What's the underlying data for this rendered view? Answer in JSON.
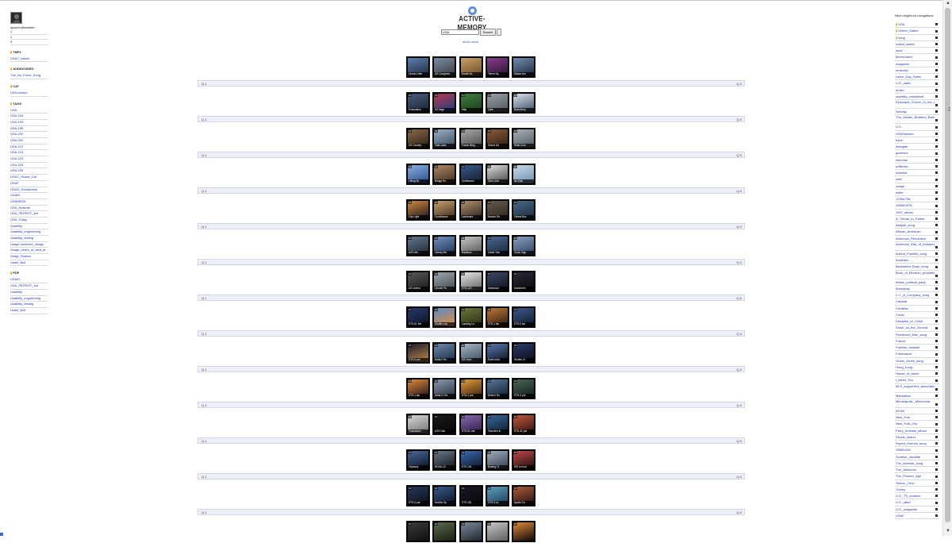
{
  "colors": {
    "link": "#2233bb",
    "accent": "#f29a00",
    "bar_bg": "#eef0f8",
    "logo": "#5f8fd8"
  },
  "left": {
    "username": "spacevi@wanted",
    "numbers": [
      "1",
      "2",
      "3"
    ],
    "sections": [
      {
        "title": "TMPL",
        "items": [
          "USAC_tracks"
        ]
      },
      {
        "title": "AUDIO/VIDEO",
        "items": [
          "The_Air_Force_Song"
        ]
      },
      {
        "title": "CAT",
        "items": [
          "USA-camps"
        ]
      },
      {
        "title": "TAGS",
        "items": [
          "USA",
          "USA-184",
          "USA-193",
          "USA-195",
          "USA-200",
          "USA-202",
          "USA-212",
          "USA-213",
          "USA-223",
          "USA-225",
          "USA-226",
          "USAC_Snack_Car",
          "USAF",
          "USAG_Humphreys",
          "USAID",
          "USAMRIID",
          "USA_Network",
          "USA_PATRIOT_Act",
          "USA_Today",
          "Usability",
          "Usability_engineering",
          "Usability_testing",
          "Usage-centered_design",
          "Usage_share_of_web_br",
          "Usagi_Tsukino",
          "Usain_Bolt"
        ]
      },
      {
        "title": "PDF",
        "items": [
          "USAID",
          "USA_PATRIOT_Act",
          "Usability",
          "Usability_engineering",
          "Usability_testing",
          "Usain_Bolt"
        ]
      }
    ]
  },
  "header": {
    "logo_text": "ACTIVE-MEMORY",
    "logo_icon": "emblem-icon",
    "search_value": "USA",
    "search_button": "Search",
    "show_users": "show users"
  },
  "rows": [
    {
      "left": "Q-1",
      "right": "Q-0",
      "thumbs": [
        {
          "caption": "Ocean Liber",
          "badge": "",
          "tone": [
            "#5b7fb0",
            "#1f2a3a"
          ]
        },
        {
          "caption": "US Congress",
          "badge": "",
          "tone": [
            "#7b8ea8",
            "#3a3a3a"
          ]
        },
        {
          "caption": "Death Va",
          "badge": "",
          "tone": [
            "#c9a26a",
            "#6b4a24"
          ]
        },
        {
          "caption": "Times Sq",
          "badge": "",
          "tone": [
            "#8c3d8c",
            "#24142e"
          ]
        },
        {
          "caption": "Statue Am",
          "badge": "",
          "tone": [
            "#6f8bb4",
            "#20293a"
          ]
        }
      ]
    },
    {
      "left": "Q-1",
      "right": "Q-0",
      "thumbs": [
        {
          "caption": "Evacuation",
          "badge": "10",
          "tone": [
            "#4a5e80",
            "#1a2230"
          ]
        },
        {
          "caption": "US flags",
          "badge": "10",
          "tone": [
            "#b23a48",
            "#1f3e8a"
          ]
        },
        {
          "caption": "Map",
          "badge": "10",
          "tone": [
            "#3f7f3f",
            "#1c3a1c"
          ]
        },
        {
          "caption": "Lake",
          "badge": "10",
          "tone": [
            "#9aa0a8",
            "#50565e"
          ]
        },
        {
          "caption": "Boat Army",
          "badge": "10",
          "tone": [
            "#e0e4ea",
            "#3a4a6a"
          ]
        }
      ]
    },
    {
      "left": "Q-1",
      "right": "Q-0",
      "thumbs": [
        {
          "caption": "US Cavalry",
          "badge": "10",
          "tone": [
            "#8a6a4a",
            "#2a1f14"
          ]
        },
        {
          "caption": "Falls Lake",
          "badge": "10",
          "tone": [
            "#9ab0c8",
            "#3a4a5a"
          ]
        },
        {
          "caption": "Frame Bldg",
          "badge": "10",
          "tone": [
            "#a8a8a8",
            "#4a4a4a"
          ]
        },
        {
          "caption": "Grand Lib",
          "badge": "10",
          "tone": [
            "#8a5a3a",
            "#2e1e14"
          ]
        },
        {
          "caption": "Shall Com",
          "badge": "10",
          "tone": [
            "#a8b0b8",
            "#505860"
          ]
        }
      ]
    },
    {
      "left": "Q-1",
      "right": "Q-0",
      "thumbs": [
        {
          "caption": "Lifting Sp",
          "badge": "10",
          "tone": [
            "#8ab0e0",
            "#2a4a8a"
          ]
        },
        {
          "caption": "Bridge Ro",
          "badge": "10",
          "tone": [
            "#b08a6a",
            "#3a2a1e"
          ]
        },
        {
          "caption": "Gulfstream",
          "badge": "10",
          "tone": [
            "#3a5a8a",
            "#101a2a"
          ]
        },
        {
          "caption": "Ohio Univ",
          "badge": "10",
          "tone": [
            "#e0e0e0",
            "#404040"
          ]
        },
        {
          "caption": "Air Ship",
          "badge": "10",
          "tone": [
            "#c8d8e8",
            "#7090b0"
          ]
        }
      ]
    },
    {
      "left": "Q-1",
      "right": "Q-0",
      "thumbs": [
        {
          "caption": "City Light",
          "badge": "10",
          "tone": [
            "#d08a3a",
            "#1a1420"
          ]
        },
        {
          "caption": "Courthouse",
          "badge": "10",
          "tone": [
            "#c8a070",
            "#3a2a1a"
          ]
        },
        {
          "caption": "Landmark",
          "badge": "10",
          "tone": [
            "#b09070",
            "#2a2018"
          ]
        },
        {
          "caption": "Barack Ob",
          "badge": "10",
          "tone": [
            "#6a5a4a",
            "#2a2420"
          ]
        },
        {
          "caption": "Oldest Bus",
          "badge": "10",
          "tone": [
            "#4a6a8a",
            "#1a2a3a"
          ]
        }
      ]
    },
    {
      "left": "Q-1",
      "right": "Q-0",
      "thumbs": [
        {
          "caption": "USS Ale",
          "badge": "10",
          "tone": [
            "#607890",
            "#202830"
          ]
        },
        {
          "caption": "Liberty Bel",
          "badge": "10",
          "tone": [
            "#7090c0",
            "#203050"
          ]
        },
        {
          "caption": "Rainbow",
          "badge": "10",
          "tone": [
            "#c8c8c8",
            "#505050"
          ]
        },
        {
          "caption": "Cable Tow",
          "badge": "10",
          "tone": [
            "#4a6a9a",
            "#1a2434"
          ]
        },
        {
          "caption": "Clock Sign",
          "badge": "10",
          "tone": [
            "#8aa0c0",
            "#304060"
          ]
        }
      ]
    },
    {
      "left": "Q-1",
      "right": "Q-0",
      "thumbs": [
        {
          "caption": "US Undrst",
          "badge": "10",
          "tone": [
            "#5a5a5a",
            "#181818"
          ]
        },
        {
          "caption": "Lincoln Pa",
          "badge": "10",
          "tone": [
            "#a0a8b0",
            "#404850"
          ]
        },
        {
          "caption": "STS-120",
          "badge": "10",
          "tone": [
            "#e8e8e8",
            "#606060"
          ]
        },
        {
          "caption": "Astronaut",
          "badge": "10",
          "tone": [
            "#3a4a6a",
            "#101018"
          ]
        },
        {
          "caption": "Astrohelm",
          "badge": "10",
          "tone": [
            "#2a2a3a",
            "#08080c"
          ]
        }
      ]
    },
    {
      "left": "Q-1",
      "right": "Q-0",
      "thumbs": [
        {
          "caption": "STS-51 Me",
          "badge": "10",
          "tone": [
            "#2a3a6a",
            "#0a1020"
          ]
        },
        {
          "caption": "Shuttle Lau",
          "badge": "10",
          "tone": [
            "#5a8ac0",
            "#e09040"
          ]
        },
        {
          "caption": "Landing La",
          "badge": "10",
          "tone": [
            "#6a7a3a",
            "#2a2a14"
          ]
        },
        {
          "caption": "STS-1 lau",
          "badge": "10",
          "tone": [
            "#c07a3a",
            "#2a1a10"
          ]
        },
        {
          "caption": "STS-5 lau",
          "badge": "10",
          "tone": [
            "#3a5a8a",
            "#101828"
          ]
        }
      ]
    },
    {
      "left": "Q-1",
      "right": "Q-0",
      "thumbs": [
        {
          "caption": "STS-9 pre",
          "badge": "10",
          "tone": [
            "#1a1a2a",
            "#c08a4a"
          ]
        },
        {
          "caption": "Delta II Ro",
          "badge": "10",
          "tone": [
            "#6a8ab0",
            "#1a2a40"
          ]
        },
        {
          "caption": "ISS Mod",
          "badge": "10",
          "tone": [
            "#a8b8c8",
            "#3a4a5a"
          ]
        },
        {
          "caption": "Earth orbit",
          "badge": "10",
          "tone": [
            "#5a7ab0",
            "#0a1020"
          ]
        },
        {
          "caption": "Shuttle Cr",
          "badge": "10",
          "tone": [
            "#2a3a6a",
            "#080c18"
          ]
        }
      ]
    },
    {
      "left": "Q-1",
      "right": "Q-0",
      "thumbs": [
        {
          "caption": "STS-1 lau",
          "badge": "10",
          "tone": [
            "#e08a3a",
            "#1a1018"
          ]
        },
        {
          "caption": "Delta IV Ro",
          "badge": "10",
          "tone": [
            "#8a9ab0",
            "#2a3040"
          ]
        },
        {
          "caption": "STS-2 pre",
          "badge": "10",
          "tone": [
            "#e0a040",
            "#3a1a08"
          ]
        },
        {
          "caption": "Delta II Ro",
          "badge": "10",
          "tone": [
            "#5a7aa0",
            "#101a28"
          ]
        },
        {
          "caption": "STS-3 pre",
          "badge": "10",
          "tone": [
            "#4a6a5a",
            "#101814"
          ]
        }
      ]
    },
    {
      "left": "Q-1",
      "right": "Q-0",
      "thumbs": [
        {
          "caption": "Truckdown",
          "badge": "10",
          "tone": [
            "#d8d8d8",
            "#707070"
          ]
        },
        {
          "caption": "USS Dan",
          "badge": "10",
          "tone": [
            "#1a1a1a",
            "#050505"
          ]
        },
        {
          "caption": "STS-51 mis",
          "badge": "10",
          "tone": [
            "#8a6ab0",
            "#2a1a40"
          ]
        },
        {
          "caption": "Teachers in",
          "badge": "10",
          "tone": [
            "#3a6a9a",
            "#0a1a2a"
          ]
        },
        {
          "caption": "STS-41 pat",
          "badge": "10",
          "tone": [
            "#c05a3a",
            "#2a1010"
          ]
        }
      ]
    },
    {
      "left": "Q-1",
      "right": "Q-0",
      "thumbs": [
        {
          "caption": "Odyssey",
          "badge": "10",
          "tone": [
            "#4a6a9a",
            "#0a1020"
          ]
        },
        {
          "caption": "NOAA-13",
          "badge": "10",
          "tone": [
            "#6a7a8a",
            "#101418"
          ]
        },
        {
          "caption": "STS 104",
          "badge": "10",
          "tone": [
            "#3a6ab0",
            "#0a1428"
          ]
        },
        {
          "caption": "Boeing 74",
          "badge": "10",
          "tone": [
            "#a0b0c0",
            "#303a48"
          ]
        },
        {
          "caption": "ISS in mod",
          "badge": "10",
          "tone": [
            "#c04a4a",
            "#1a0a0a"
          ]
        }
      ]
    },
    {
      "left": "Q-1",
      "right": "Q-0",
      "thumbs": [
        {
          "caption": "STS-5 pat",
          "badge": "10",
          "tone": [
            "#2a3a5a",
            "#080c14"
          ]
        },
        {
          "caption": "Hubble Sp",
          "badge": "10",
          "tone": [
            "#3a5a8a",
            "#0a1020"
          ]
        },
        {
          "caption": "STS 115",
          "badge": "10",
          "tone": [
            "#1a1a2a",
            "#050508"
          ]
        },
        {
          "caption": "STS 5 La",
          "badge": "10",
          "tone": [
            "#5aa0c0",
            "#203a50"
          ]
        },
        {
          "caption": "Apollo Su",
          "badge": "10",
          "tone": [
            "#b05a3a",
            "#201010"
          ]
        }
      ]
    },
    {
      "left": "",
      "right": "",
      "thumbs": [
        {
          "caption": "",
          "badge": "10",
          "tone": [
            "#3a3a3a",
            "#101010"
          ]
        },
        {
          "caption": "",
          "badge": "10",
          "tone": [
            "#5a6a4a",
            "#1a2014"
          ]
        },
        {
          "caption": "",
          "badge": "10",
          "tone": [
            "#7a8a9a",
            "#202830"
          ]
        },
        {
          "caption": "",
          "badge": "10",
          "tone": [
            "#c8c8c8",
            "#606060"
          ]
        },
        {
          "caption": "",
          "badge": "10",
          "tone": [
            "#e08a3a",
            "#100808"
          ]
        }
      ]
    }
  ],
  "right": {
    "title": "Next neighbour navigations",
    "items": [
      {
        "label": "USA",
        "mark": true
      },
      {
        "label": "United_States",
        "mark": true
      },
      {
        "label": "song",
        "mark": true
      },
      {
        "label": "united_states",
        "mark": false
      },
      {
        "label": "actor",
        "mark": false
      },
      {
        "label": "Mormonism",
        "mark": false
      },
      {
        "label": "magazine",
        "mark": false
      },
      {
        "label": "musician",
        "mark": false
      },
      {
        "label": "Labor_Day_Sales",
        "mark": false
      },
      {
        "label": "U.S._state",
        "mark": false
      },
      {
        "label": "music",
        "mark": false
      },
      {
        "label": "usability_consultant",
        "mark": false
      },
      {
        "label": "Episcopal_Church_in_the_United",
        "mark": false,
        "tall": true
      },
      {
        "label": "Norway",
        "mark": false
      },
      {
        "label": "The_Allman_Brothers_Band",
        "mark": false,
        "tall": true
      },
      {
        "label": "U.S.",
        "mark": false
      },
      {
        "label": "USASweden",
        "mark": false
      },
      {
        "label": "band",
        "mark": false
      },
      {
        "label": "delegate",
        "mark": false
      },
      {
        "label": "governor",
        "mark": false
      },
      {
        "label": "historian",
        "mark": false
      },
      {
        "label": "politician",
        "mark": false
      },
      {
        "label": "scientist",
        "mark": false
      },
      {
        "label": "usaf",
        "mark": false
      },
      {
        "label": "usage",
        "mark": false
      },
      {
        "label": "writer",
        "mark": false
      },
      {
        "label": "1236&798",
        "mark": false
      },
      {
        "label": "1985&2076",
        "mark": false
      },
      {
        "label": "1997_album",
        "mark": false
      },
      {
        "label": "A_Tribute_to_Father",
        "mark": false
      },
      {
        "label": "Aaliyah_song",
        "mark": false
      },
      {
        "label": "African_American",
        "mark": false
      },
      {
        "label": "American_Revolution",
        "mark": false
      },
      {
        "label": "American_War_of_Independence",
        "mark": false,
        "tall": true
      },
      {
        "label": "Aretha_Franklin_song",
        "mark": false
      },
      {
        "label": "Australia",
        "mark": false
      },
      {
        "label": "Backstreet_Boys_song",
        "mark": false
      },
      {
        "label": "Book_of_Mormon_prophets",
        "mark": false,
        "tall": true
      },
      {
        "label": "British_political_party",
        "mark": false
      },
      {
        "label": "Broadway",
        "mark": false
      },
      {
        "label": "C.J._&_Company_song",
        "mark": false
      },
      {
        "label": "Canada",
        "mark": false
      },
      {
        "label": "Christian",
        "mark": false
      },
      {
        "label": "Creek",
        "mark": false
      },
      {
        "label": "Disciples_of_Christ",
        "mark": false
      },
      {
        "label": "Down_on_the_Ground",
        "mark": false
      },
      {
        "label": "Fleetwood_Mac_song",
        "mark": false
      },
      {
        "label": "France",
        "mark": false
      },
      {
        "label": "Franklin_Institute",
        "mark": false
      },
      {
        "label": "Freemason",
        "mark": false
      },
      {
        "label": "Grace_Jones_song",
        "mark": false
      },
      {
        "label": "Hong_Kong",
        "mark": false
      },
      {
        "label": "House_of_Islam",
        "mark": false
      },
      {
        "label": "I_Need_You",
        "mark": false
      },
      {
        "label": "MLS_supporters_association",
        "mark": false,
        "tall": true
      },
      {
        "label": "Manhattan",
        "mark": false
      },
      {
        "label": "Minneapolis,_Minnesota",
        "mark": false,
        "tall": true
      },
      {
        "label": "NCAA",
        "mark": false
      },
      {
        "label": "New_York",
        "mark": false
      },
      {
        "label": "New_York_City",
        "mark": false
      },
      {
        "label": "Parry_Animals_album",
        "mark": false
      },
      {
        "label": "Rhode_Island",
        "mark": false
      },
      {
        "label": "Rupert_Holmes_song",
        "mark": false
      },
      {
        "label": "SSBN-640",
        "mark": false
      },
      {
        "label": "Scottish_Jacobite",
        "mark": false
      },
      {
        "label": "The_Animals_song",
        "mark": false
      },
      {
        "label": "The_Jacksons",
        "mark": false
      },
      {
        "label": "The_Pioneer_Age",
        "mark": false
      },
      {
        "label": "Toledo,_Ohio",
        "mark": false
      },
      {
        "label": "Turkey",
        "mark": false
      },
      {
        "label": "U.S._TV_channel",
        "mark": false
      },
      {
        "label": "U.S._label",
        "mark": false
      },
      {
        "label": "U.S._magazine",
        "mark": false
      },
      {
        "label": "USAF",
        "mark": false
      }
    ]
  }
}
